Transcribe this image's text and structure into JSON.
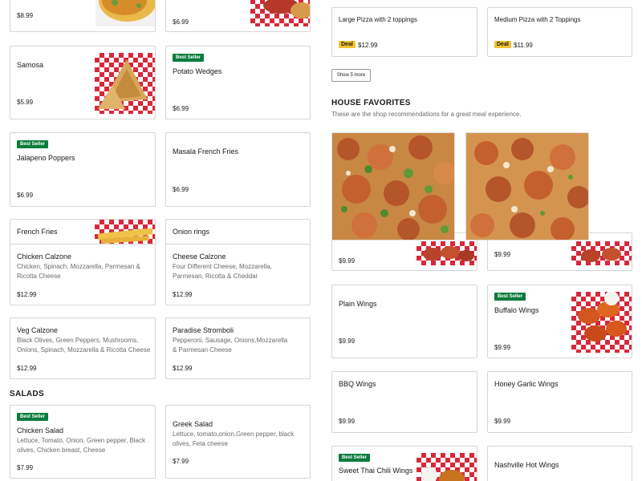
{
  "left_column": {
    "cards": [
      {
        "id": "top-left",
        "price": "$8.99"
      },
      {
        "id": "top-right",
        "price": "$6.99"
      },
      {
        "id": "samosa",
        "name": "Samosa",
        "price": "$5.99"
      },
      {
        "id": "potato-wedges",
        "badge": "Best Seller",
        "name": "Potato Wedges",
        "price": "$6.99"
      },
      {
        "id": "jalapeno-poppers",
        "badge": "Best Seller",
        "name": "Jalapeno Poppers",
        "price": "$6.99"
      },
      {
        "id": "masala-fries",
        "name": "Masala French Fries",
        "price": "$6.99"
      },
      {
        "id": "french-fries",
        "name": "French Fries"
      },
      {
        "id": "onion-rings",
        "name": "Onion rings"
      },
      {
        "id": "chicken-calzone",
        "name": "Chicken Calzone",
        "desc": "Chicken, Spinach, Mozzarella, Parmesan & Ricotta Cheese",
        "price": "$12.99"
      },
      {
        "id": "cheese-calzone",
        "name": "Cheese Calzone",
        "desc": "Four Different Cheese, Mozzarella, Parmesan, Ricotta & Cheddar",
        "price": "$12.99"
      },
      {
        "id": "veg-calzone",
        "name": "Veg Calzone",
        "desc": "Black Olives, Green Peppers, Mushrooms, Onions, Spinach, Mozzarella & Ricotta Cheese",
        "price": "$12.99"
      },
      {
        "id": "paradise-stromboli",
        "name": "Paradise Stromboli",
        "desc": "Pepperoni, Sausage, Onions,Mozzarella & Parmesan Cheese",
        "price": "$12.99"
      }
    ],
    "salads_title": "SALADS",
    "salads": [
      {
        "id": "chicken-salad",
        "badge": "Best Seller",
        "name": "Chicken Salad",
        "desc": "Lettuce, Tomato, Onion, Green pepper, Black olives, Chicken breast, Cheese",
        "price": "$7.99"
      },
      {
        "id": "greek-salad",
        "name": "Greek Salad",
        "desc": "Lettuce, tomato,onion,Green pepper, black olives, Feta cheese",
        "price": "$7.99"
      }
    ]
  },
  "right_column": {
    "deals": [
      {
        "name": "Large Pizza with 2 toppings",
        "deal_label": "Deal",
        "price": "$12.99"
      },
      {
        "name": "Medium Pizza with 2 Toppings",
        "deal_label": "Deal",
        "price": "$11.99"
      }
    ],
    "show_more": "Show 5 more",
    "house_favorites": {
      "title": "HOUSE FAVORITES",
      "subtitle": "These are the shop recommendations for a great meal experience."
    },
    "wings": [
      {
        "id": "wing-a",
        "price": "$9.99"
      },
      {
        "id": "wing-b",
        "price": "$9.99"
      },
      {
        "id": "plain-wings",
        "name": "Plain Wings",
        "price": "$9.99"
      },
      {
        "id": "buffalo-wings",
        "badge": "Best Seller",
        "name": "Buffalo Wings",
        "price": "$9.99"
      },
      {
        "id": "bbq-wings",
        "name": "BBQ Wings",
        "price": "$9.99"
      },
      {
        "id": "honey-garlic-wings",
        "name": "Honey Garlic Wings",
        "price": "$9.99"
      },
      {
        "id": "sweet-thai-chili-wings",
        "badge": "Best Seller",
        "name": "Sweet Thai Chili Wings"
      },
      {
        "id": "nashville-hot-wings",
        "name": "Nashville Hot Wings"
      }
    ]
  },
  "colors": {
    "badge_green": "#0a7c3b",
    "deal_yellow": "#f2c230",
    "checker_red": "#d8283b",
    "border": "#d6d6d6"
  }
}
